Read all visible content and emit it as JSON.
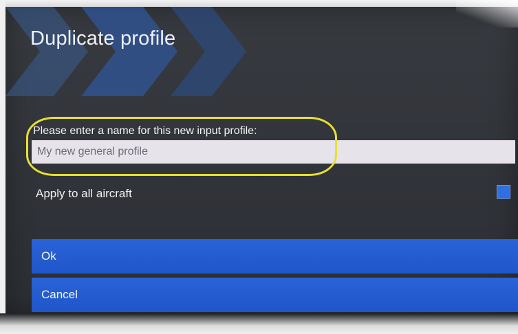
{
  "dialog": {
    "title": "Duplicate profile",
    "prompt_label": "Please enter a name for this new input profile:",
    "name_input": {
      "value": "My new general profile"
    },
    "apply_all": {
      "label": "Apply to all aircraft",
      "checked": true
    },
    "buttons": {
      "ok_label": "Ok",
      "cancel_label": "Cancel"
    }
  },
  "colors": {
    "dialog_background": "#2f3238",
    "button_blue": "#2460d4",
    "checkbox_blue": "#2f6fe0",
    "highlight_yellow": "#e7e032",
    "input_background": "#e6e3ea"
  }
}
